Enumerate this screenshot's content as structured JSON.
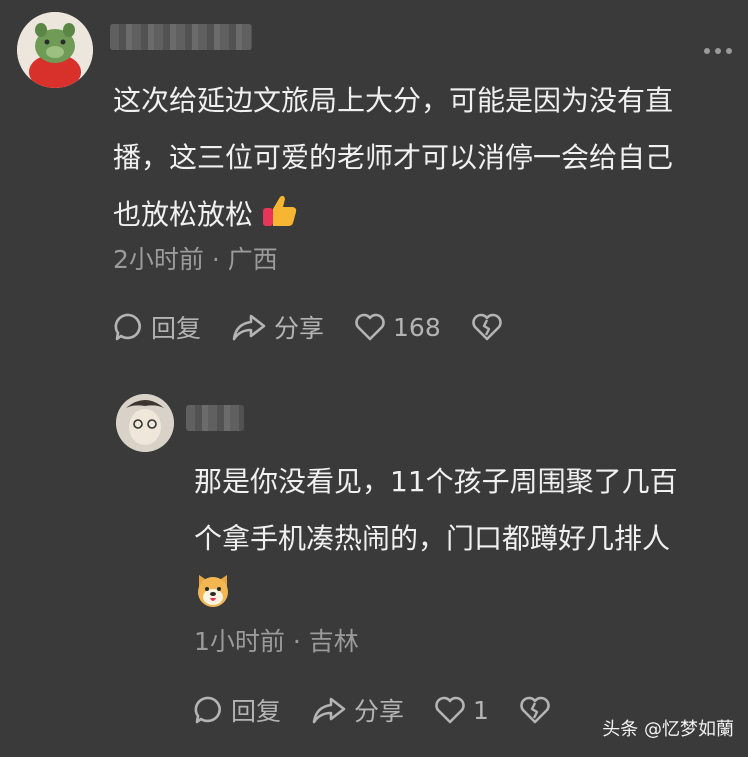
{
  "comment": {
    "text_lines": [
      "这次给延边文旅局上大分，可能是因为没有直",
      "播，这三位可爱的老师才可以消停一会给自己",
      "也放松放松"
    ],
    "emoji": "thumbs-up-emoji",
    "time": "2小时前",
    "location": "广西",
    "separator": "·",
    "actions": {
      "reply": "回复",
      "share": "分享",
      "likes": "168"
    }
  },
  "reply": {
    "text_lines": [
      "那是你没看见，11个孩子周围聚了几百",
      "个拿手机凑热闹的，门口都蹲好几排人"
    ],
    "emoji": "dog-face-emoji",
    "time": "1小时前",
    "location": "吉林",
    "separator": "·",
    "actions": {
      "reply": "回复",
      "share": "分享",
      "likes": "1"
    }
  },
  "watermark": "头条 @忆梦如蘭",
  "colors": {
    "background": "#3a3a3a",
    "text": "#f0f0f0",
    "meta": "#9b9b9b",
    "icon": "#b4b4b4"
  }
}
